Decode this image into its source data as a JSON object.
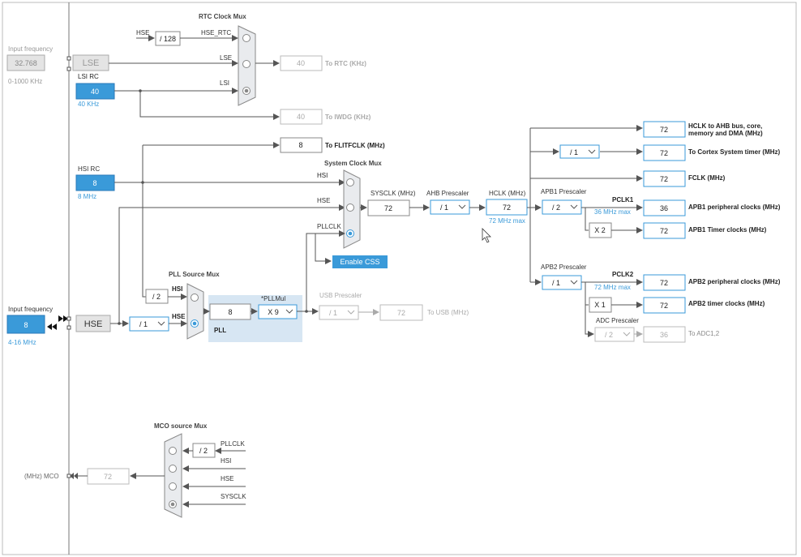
{
  "titles": {
    "rtc_mux": "RTC Clock Mux",
    "sysclk_mux": "System Clock Mux",
    "pll_src_mux": "PLL Source Mux",
    "mco_src_mux": "MCO source Mux"
  },
  "lse": {
    "input_label": "Input frequency",
    "value": "32.768",
    "range": "0-1000 KHz",
    "name": "LSE"
  },
  "lsi": {
    "name": "LSI RC",
    "value": "40",
    "freq": "40 KHz"
  },
  "hsi": {
    "name": "HSI RC",
    "value": "8",
    "freq": "8 MHz"
  },
  "hse": {
    "input_label": "Input frequency",
    "value": "8",
    "range": "4-16 MHz",
    "name": "HSE"
  },
  "rtc": {
    "hse_label": "HSE",
    "div": "/ 128",
    "hse_rtc": "HSE_RTC",
    "lse": "LSE",
    "lsi": "LSI",
    "out": "40",
    "out_label": "To RTC (KHz)"
  },
  "iwdg": {
    "out": "40",
    "out_label": "To IWDG (KHz)"
  },
  "flitf": {
    "out": "8",
    "out_label": "To FLITFCLK (MHz)"
  },
  "sysmux": {
    "hsi": "HSI",
    "hse": "HSE",
    "pllclk": "PLLCLK",
    "enable_css": "Enable CSS"
  },
  "sysclk": {
    "label": "SYSCLK (MHz)",
    "value": "72"
  },
  "ahb": {
    "label": "AHB Prescaler",
    "value": "/ 1"
  },
  "hclk": {
    "label": "HCLK (MHz)",
    "value": "72",
    "max": "72 MHz max"
  },
  "outputs": {
    "hclk_ahb": {
      "value": "72",
      "label1": "HCLK to AHB bus, core,",
      "label2": "memory and DMA (MHz)"
    },
    "cortex": {
      "div": "/ 1",
      "value": "72",
      "label": "To Cortex System timer (MHz)"
    },
    "fclk": {
      "value": "72",
      "label": "FCLK (MHz)"
    },
    "apb1": {
      "presc_label": "APB1 Prescaler",
      "presc": "/ 2",
      "pclk": "PCLK1",
      "max": "36 MHz max",
      "value": "36",
      "label": "APB1 peripheral clocks (MHz)"
    },
    "apb1_timer": {
      "mult": "X 2",
      "value": "72",
      "label": "APB1 Timer clocks (MHz)"
    },
    "apb2": {
      "presc_label": "APB2 Prescaler",
      "presc": "/ 1",
      "pclk": "PCLK2",
      "max": "72 MHz max",
      "value": "72",
      "label": "APB2 peripheral clocks (MHz)"
    },
    "apb2_timer": {
      "mult": "X 1",
      "value": "72",
      "label": "APB2 timer clocks (MHz)"
    },
    "adc": {
      "presc_label": "ADC Prescaler",
      "presc": "/ 2",
      "value": "36",
      "label": "To ADC1,2"
    }
  },
  "pll": {
    "hsi": "HSI",
    "hse": "HSE",
    "hsi_div": "/ 2",
    "hse_div": "/ 1",
    "value": "8",
    "mul_label": "*PLLMul",
    "mul": "X 9",
    "name": "PLL"
  },
  "usb": {
    "label": "USB Prescaler",
    "presc": "/ 1",
    "value": "72",
    "out_label": "To USB (MHz)"
  },
  "mco": {
    "pllclk": "PLLCLK",
    "div": "/ 2",
    "hsi": "HSI",
    "hse": "HSE",
    "sysclk": "SYSCLK",
    "value": "72",
    "label": "(MHz) MCO"
  }
}
